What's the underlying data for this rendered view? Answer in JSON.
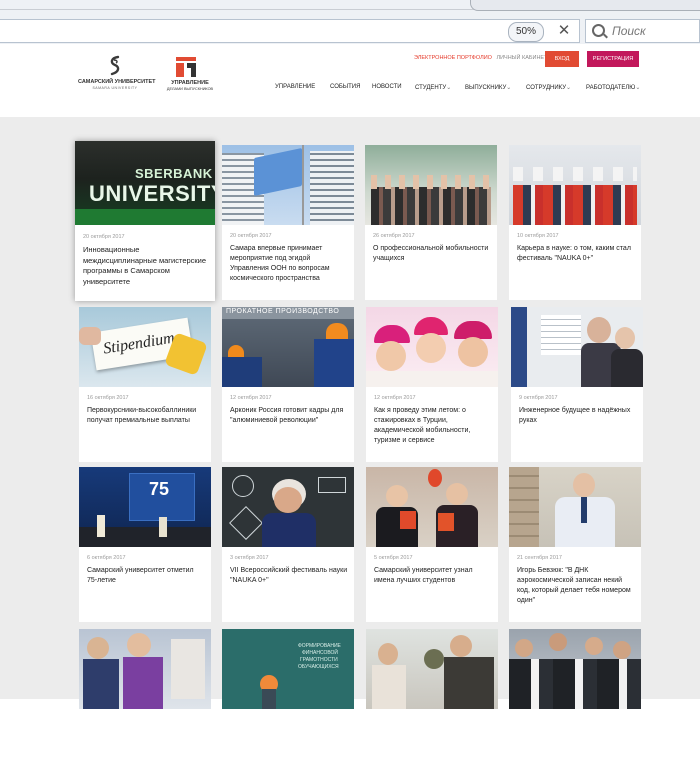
{
  "browser": {
    "zoom": "50%",
    "search_placeholder": "Поиск"
  },
  "header": {
    "logo_university_name": "САМАРСКИЙ УНИВЕРСИТЕТ",
    "logo_university_sub": "SAMARA UNIVERSITY",
    "logo_dept_line1": "УПРАВЛЕНИЕ",
    "logo_dept_line2": "ДЕЛАМИ ВЫПУСКНИКОВ",
    "link_portfolio": "ЭЛЕКТРОННОЕ ПОРТФОЛИО",
    "link_cabinet": "ЛИЧНЫЙ КАБИНЕТ",
    "login_label": "ВХОД",
    "register_label": "РЕГИСТРАЦИЯ",
    "nav": [
      "УПРАВЛЕНИЕ",
      "СОБЫТИЯ",
      "НОВОСТИ",
      "СТУДЕНТУ",
      "ВЫПУСКНИКУ",
      "СОТРУДНИКУ",
      "РАБОТОДАТЕЛЮ"
    ]
  },
  "thumb_texts": {
    "sberbank_line1": "SBERBANK",
    "sberbank_line2": "UNIVERSITY",
    "stipendium": "Stipendium",
    "factory_sign": "ПРОКАТНОЕ ПРОИЗВОДСТВО",
    "fin_gram_1": "ФОРМИРОВАНИЕ",
    "fin_gram_2": "ФИНАНСОВОЙ",
    "fin_gram_3": "ГРАМОТНОСТИ",
    "fin_gram_4": "ОБУЧАЮЩИХСЯ",
    "anniv": "75"
  },
  "news": [
    {
      "date": "20 октября 2017",
      "title": "Инновационные междисциплинарные магистерские программы в Самарском университете"
    },
    {
      "date": "20 октября 2017",
      "title": "Самара впервые принимает мероприятие под эгидой Управления ООН по вопросам космического пространства"
    },
    {
      "date": "26 октября 2017",
      "title": "О профессиональной мобильности учащихся"
    },
    {
      "date": "10 октября 2017",
      "title": "Карьера в науке: о том, каким стал фестиваль \"NAUKA 0+\""
    },
    {
      "date": "16 октября 2017",
      "title": "Первокурсники-высокобаллиники получат премиальные выплаты"
    },
    {
      "date": "12 октября 2017",
      "title": "Арконик Россия готовит кадры для \"алюминиевой революции\""
    },
    {
      "date": "12 октября 2017",
      "title": "Как я проведу этим летом: о стажировках в Турции, академической мобильности, туризме и сервисе"
    },
    {
      "date": "9 октября 2017",
      "title": "Инженерное будущее в надёжных руках"
    },
    {
      "date": "6 октября 2017",
      "title": "Самарский университет отметил 75-летие"
    },
    {
      "date": "3 октября 2017",
      "title": "VII Всероссийский фестиваль науки \"NAUKA 0+\""
    },
    {
      "date": "5 октября 2017",
      "title": "Самарский университет узнал имена лучших студентов"
    },
    {
      "date": "21 сентября 2017",
      "title": "Игорь Бевзюк: \"В ДНК аэрокосмической записан некий код, который делает тебя номером один\""
    },
    {
      "date": "",
      "title": ""
    },
    {
      "date": "",
      "title": ""
    },
    {
      "date": "",
      "title": ""
    },
    {
      "date": "",
      "title": ""
    }
  ]
}
